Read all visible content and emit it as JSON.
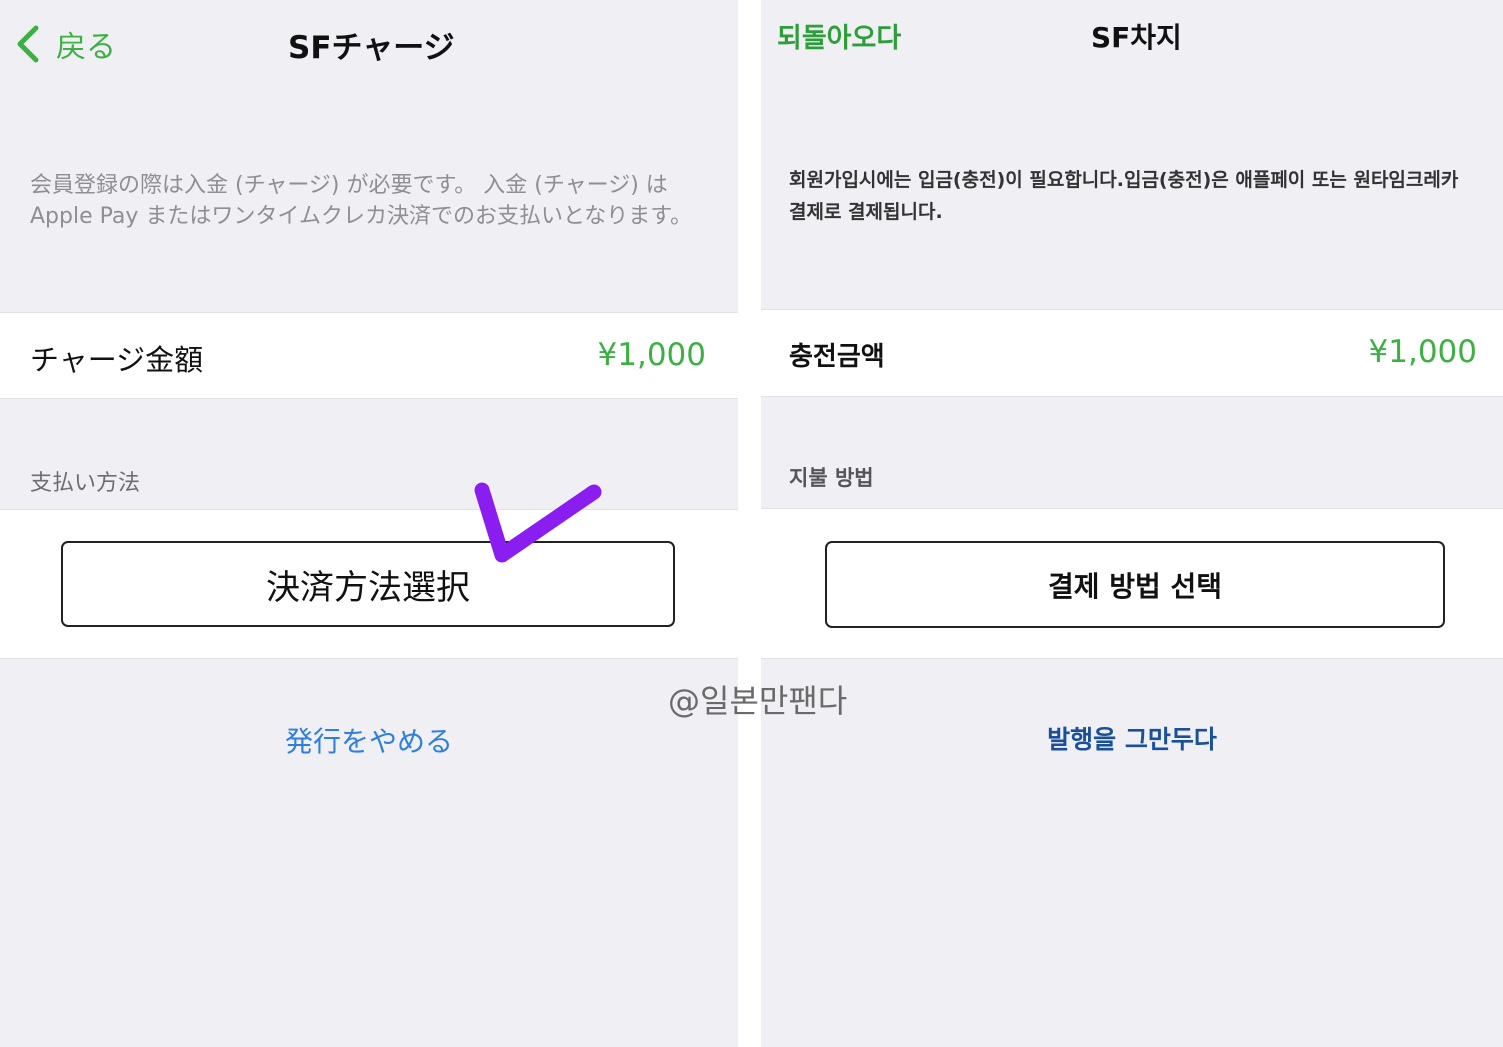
{
  "colors": {
    "accent_green": "#3cb043",
    "link_blue_ja": "#2f7fdc",
    "link_blue_ko": "#1a4f9a",
    "checkmark": "#8a1ef0"
  },
  "japanese_screen": {
    "back_icon": "chevron-left-icon",
    "back_label": "戻る",
    "title": "SFチャージ",
    "description": "会員登録の際は入金 (チャージ) が必要です。 入金 (チャージ) は Apple Pay またはワンタイムクレカ決済でのお支払いとなります。",
    "charge_label": "チャージ金額",
    "charge_value": "¥1,000",
    "payment_section": "支払い方法",
    "select_button": "決済方法選択",
    "cancel_link": "発行をやめる"
  },
  "korean_screen": {
    "back_label": "되돌아오다",
    "title": "SF차지",
    "description": "회원가입시에는 입금(충전)이 필요합니다.입금(충전)은 애플페이 또는 원타임크레카 결제로 결제됩니다.",
    "charge_label": "충전금액",
    "charge_value": "¥1,000",
    "payment_section": "지불 방법",
    "select_button": "결제 방법 선택",
    "cancel_link": "발행을 그만두다"
  },
  "watermark": "@일본만팬다"
}
